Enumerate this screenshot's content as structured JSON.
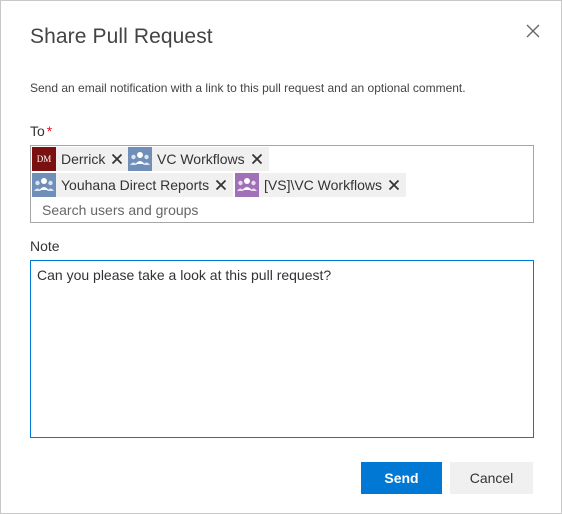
{
  "dialog": {
    "title": "Share Pull Request",
    "description": "Send an email notification with a link to this pull request and an optional comment."
  },
  "to_field": {
    "label": "To",
    "required_marker": "*",
    "recipients": [
      {
        "name": "Derrick",
        "avatar_type": "initials",
        "initials": "DM"
      },
      {
        "name": "VC Workflows",
        "avatar_type": "group"
      },
      {
        "name": "Youhana Direct Reports",
        "avatar_type": "group"
      },
      {
        "name": "[VS]\\VC Workflows",
        "avatar_type": "group"
      }
    ],
    "search_placeholder": "Search users and groups"
  },
  "note_field": {
    "label": "Note",
    "value": "Can you please take a look at this pull request?"
  },
  "buttons": {
    "send": "Send",
    "cancel": "Cancel"
  },
  "colors": {
    "primary": "#0078d4",
    "required": "#e81123",
    "avatar_initials_bg": "#7a1010",
    "group_avatar_blue": "#6f8fb8",
    "group_avatar_purple": "#a071b7"
  },
  "icons": {
    "close": "close-icon",
    "chip_remove": "remove-icon",
    "group": "group-icon"
  }
}
